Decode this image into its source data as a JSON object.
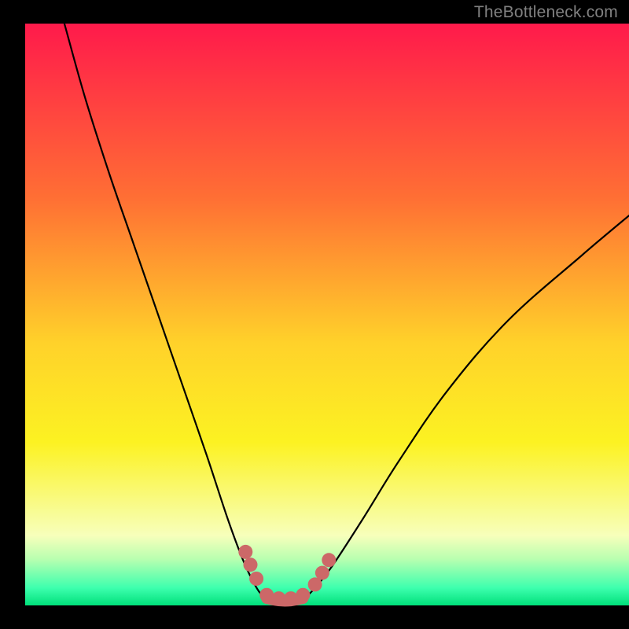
{
  "watermark": "TheBottleneck.com",
  "chart_data": {
    "type": "line",
    "title": "",
    "xlabel": "",
    "ylabel": "",
    "xlim": [
      0,
      100
    ],
    "ylim": [
      0,
      100
    ],
    "grid": false,
    "legend": false,
    "background_gradient": {
      "stops": [
        {
          "offset": 0.0,
          "color": "#ff1a4b"
        },
        {
          "offset": 0.3,
          "color": "#ff6f34"
        },
        {
          "offset": 0.55,
          "color": "#ffd22a"
        },
        {
          "offset": 0.72,
          "color": "#fcf222"
        },
        {
          "offset": 0.88,
          "color": "#f7ffbb"
        },
        {
          "offset": 0.92,
          "color": "#b9ffb0"
        },
        {
          "offset": 0.97,
          "color": "#3dffae"
        },
        {
          "offset": 1.0,
          "color": "#00e07a"
        }
      ]
    },
    "series": [
      {
        "name": "left-branch",
        "x": [
          6.5,
          10,
          14,
          18,
          22,
          26,
          30,
          33.5,
          36,
          37.8,
          39,
          40
        ],
        "y": [
          100,
          87,
          74,
          62,
          50,
          38,
          26,
          15,
          8,
          4,
          2,
          1.2
        ]
      },
      {
        "name": "valley-floor",
        "x": [
          40,
          42,
          44,
          46
        ],
        "y": [
          1.2,
          0.8,
          0.8,
          1.2
        ]
      },
      {
        "name": "right-branch",
        "x": [
          46,
          48,
          51,
          56,
          62,
          70,
          80,
          92,
          100
        ],
        "y": [
          1.2,
          3,
          7,
          15,
          25,
          37,
          49,
          60,
          67
        ]
      }
    ],
    "markers": {
      "name": "valley-dots",
      "color": "#cc6868",
      "radius": 9,
      "points": [
        {
          "x": 36.5,
          "y": 9.2
        },
        {
          "x": 37.3,
          "y": 7.0
        },
        {
          "x": 38.3,
          "y": 4.6
        },
        {
          "x": 40.0,
          "y": 1.8
        },
        {
          "x": 42.0,
          "y": 1.2
        },
        {
          "x": 44.0,
          "y": 1.2
        },
        {
          "x": 46.0,
          "y": 1.8
        },
        {
          "x": 48.0,
          "y": 3.6
        },
        {
          "x": 49.2,
          "y": 5.6
        },
        {
          "x": 50.3,
          "y": 7.8
        }
      ]
    }
  }
}
